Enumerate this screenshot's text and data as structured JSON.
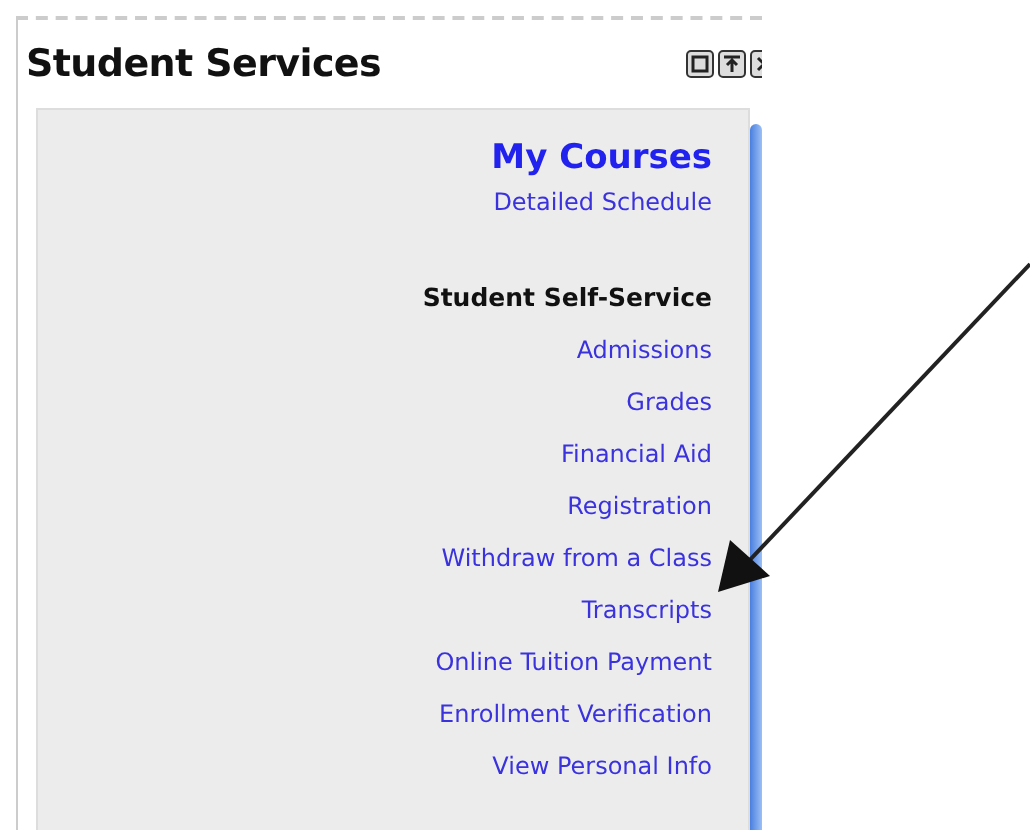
{
  "panel": {
    "title": "Student Services"
  },
  "items": [
    {
      "kind": "heading",
      "text": "My Courses"
    },
    {
      "kind": "link",
      "text": "Detailed Schedule"
    },
    {
      "kind": "section",
      "text": "Student Self-Service"
    },
    {
      "kind": "link",
      "text": "Admissions"
    },
    {
      "kind": "link",
      "text": "Grades"
    },
    {
      "kind": "link",
      "text": "Financial Aid"
    },
    {
      "kind": "link",
      "text": "Registration"
    },
    {
      "kind": "link",
      "text": "Withdraw from a Class"
    },
    {
      "kind": "link",
      "text": "Transcripts"
    },
    {
      "kind": "link",
      "text": "Online Tuition Payment"
    },
    {
      "kind": "link",
      "text": "Enrollment Verification"
    },
    {
      "kind": "link",
      "text": "View Personal Info"
    }
  ]
}
